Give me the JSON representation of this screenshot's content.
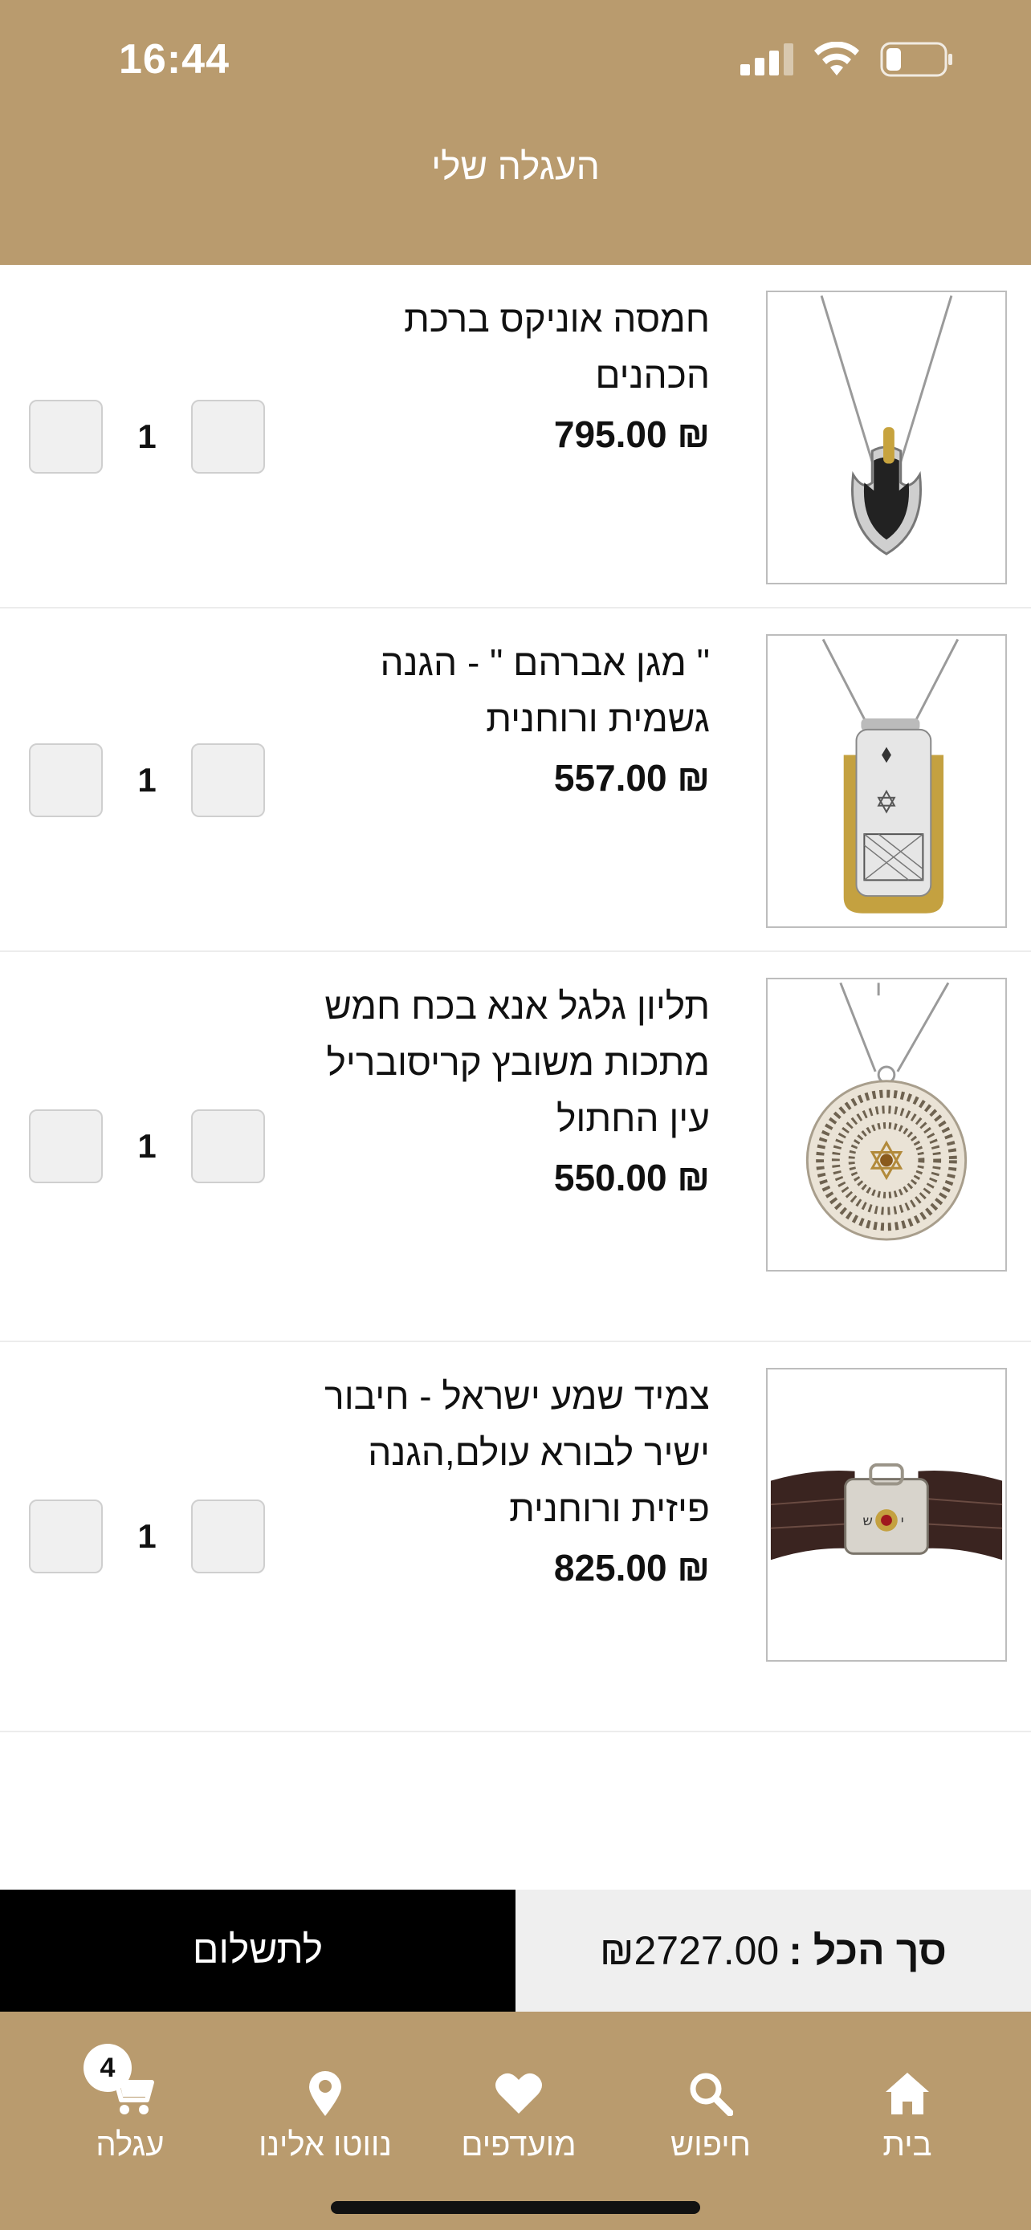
{
  "status_bar": {
    "time": "16:44"
  },
  "header": {
    "title": "העגלה שלי"
  },
  "cart": {
    "items": [
      {
        "name": "חמסה אוניקס ברכת הכהנים",
        "price": "795.00 ₪",
        "quantity": "1"
      },
      {
        "name": "\" מגן אברהם \" - הגנה גשמית ורוחנית",
        "price": "557.00 ₪",
        "quantity": "1"
      },
      {
        "name": "תליון גלגל אנא בכח חמש מתכות משובץ קריסובריל עין החתול",
        "price": "550.00 ₪",
        "quantity": "1"
      },
      {
        "name": "צמיד שמע ישראל - חיבור ישיר לבורא עולם,הגנה פיזית ורוחנית",
        "price": "825.00 ₪",
        "quantity": "1"
      }
    ]
  },
  "checkout": {
    "pay_label": "לתשלום",
    "total_label": "סך הכל :",
    "total_value": "₪2727.00"
  },
  "nav": {
    "home": "בית",
    "search": "חיפוש",
    "favorites": "מועדפים",
    "navigate": "נווטו אלינו",
    "cart": "עגלה",
    "cart_count": "4"
  },
  "colors": {
    "brand": "#b99b6e",
    "pay_button": "#000000",
    "total_bg": "#efefef"
  }
}
